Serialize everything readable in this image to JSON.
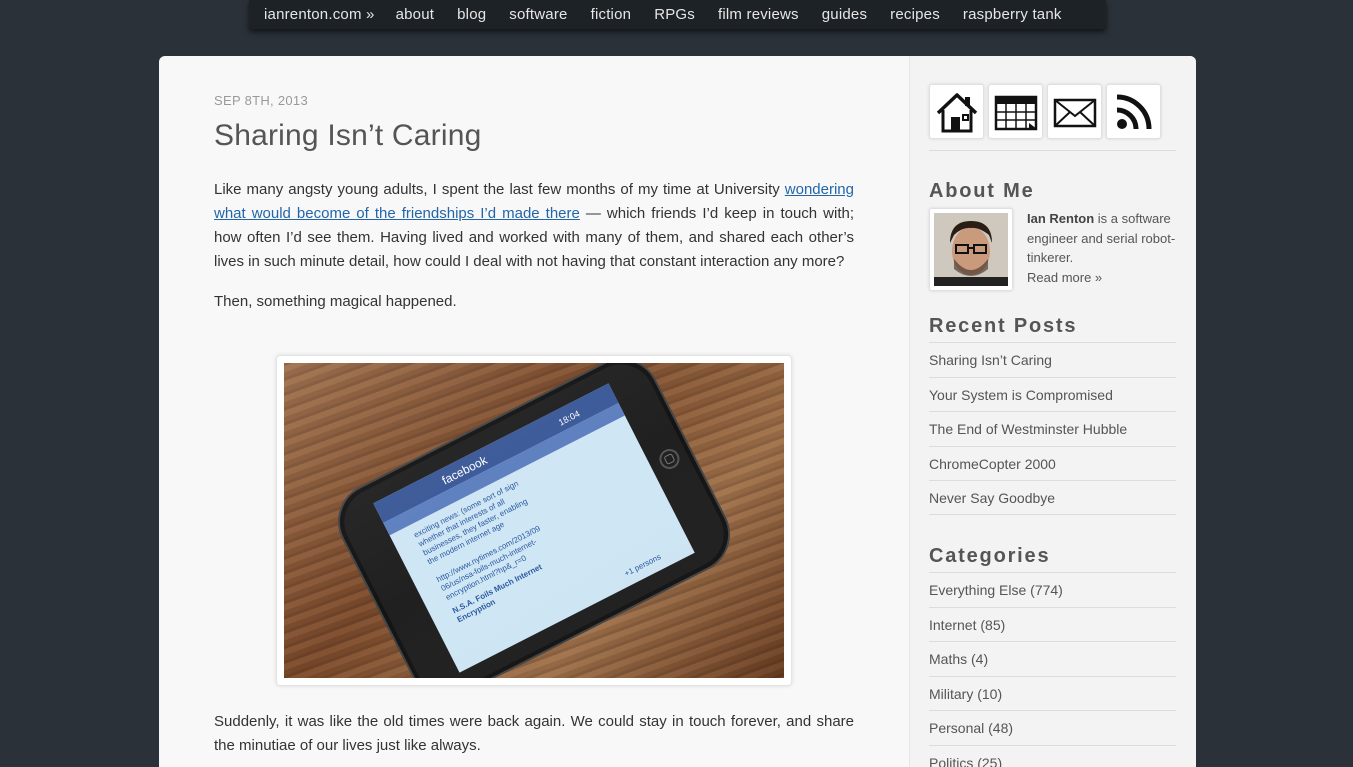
{
  "nav": {
    "site": "ianrenton.com »",
    "items": [
      "about",
      "blog",
      "software",
      "fiction",
      "RPGs",
      "film reviews",
      "guides",
      "recipes",
      "raspberry tank"
    ]
  },
  "post": {
    "date": "SEP 8TH, 2013",
    "title": "Sharing Isn’t Caring",
    "p1_before": "Like many angsty young adults, I spent the last few months of my time at University ",
    "p1_link": "wondering what would become of the friendships I’d made there",
    "p1_after": " — which friends I’d keep in touch with; how often I’d see them. Having lived and worked with many of them, and shared each other’s lives in such minute detail, how could I deal with not having that constant interaction any more?",
    "p2": "Then, something magical happened.",
    "p3": "Suddenly, it was like the old times were back again. We could stay in touch forever, and share the minutiae of our lives just like always.",
    "photo": {
      "app_title": "facebook",
      "time": "18:04",
      "status_lines": [
        "exciting news: (some sort of sign",
        "whether that interests of all",
        "businesses, they faster, enabling",
        "the modern internet age"
      ],
      "link_lines": [
        "http://www.nytimes.com/2013/09",
        "06/us/nsa-foils-much-internet-",
        "encryption.html?hp&_r=0",
        "N.S.A. Foils Much Internet",
        "Encryption"
      ],
      "footer": "+1 persons"
    }
  },
  "sidebar": {
    "icons": [
      "home-icon",
      "calendar-icon",
      "mail-icon",
      "rss-icon"
    ],
    "about_heading": "About Me",
    "about_name": "Ian Renton",
    "about_text": " is a software engineer and serial robot-tinkerer.",
    "about_more": "Read more »",
    "recent_heading": "Recent Posts",
    "recent": [
      "Sharing Isn’t Caring",
      "Your System is Compromised",
      "The End of Westminster Hubble",
      "ChromeCopter 2000",
      "Never Say Goodbye"
    ],
    "categories_heading": "Categories",
    "categories": [
      "Everything Else (774)",
      "Internet (85)",
      "Maths (4)",
      "Military (10)",
      "Personal (48)",
      "Politics (25)"
    ]
  }
}
